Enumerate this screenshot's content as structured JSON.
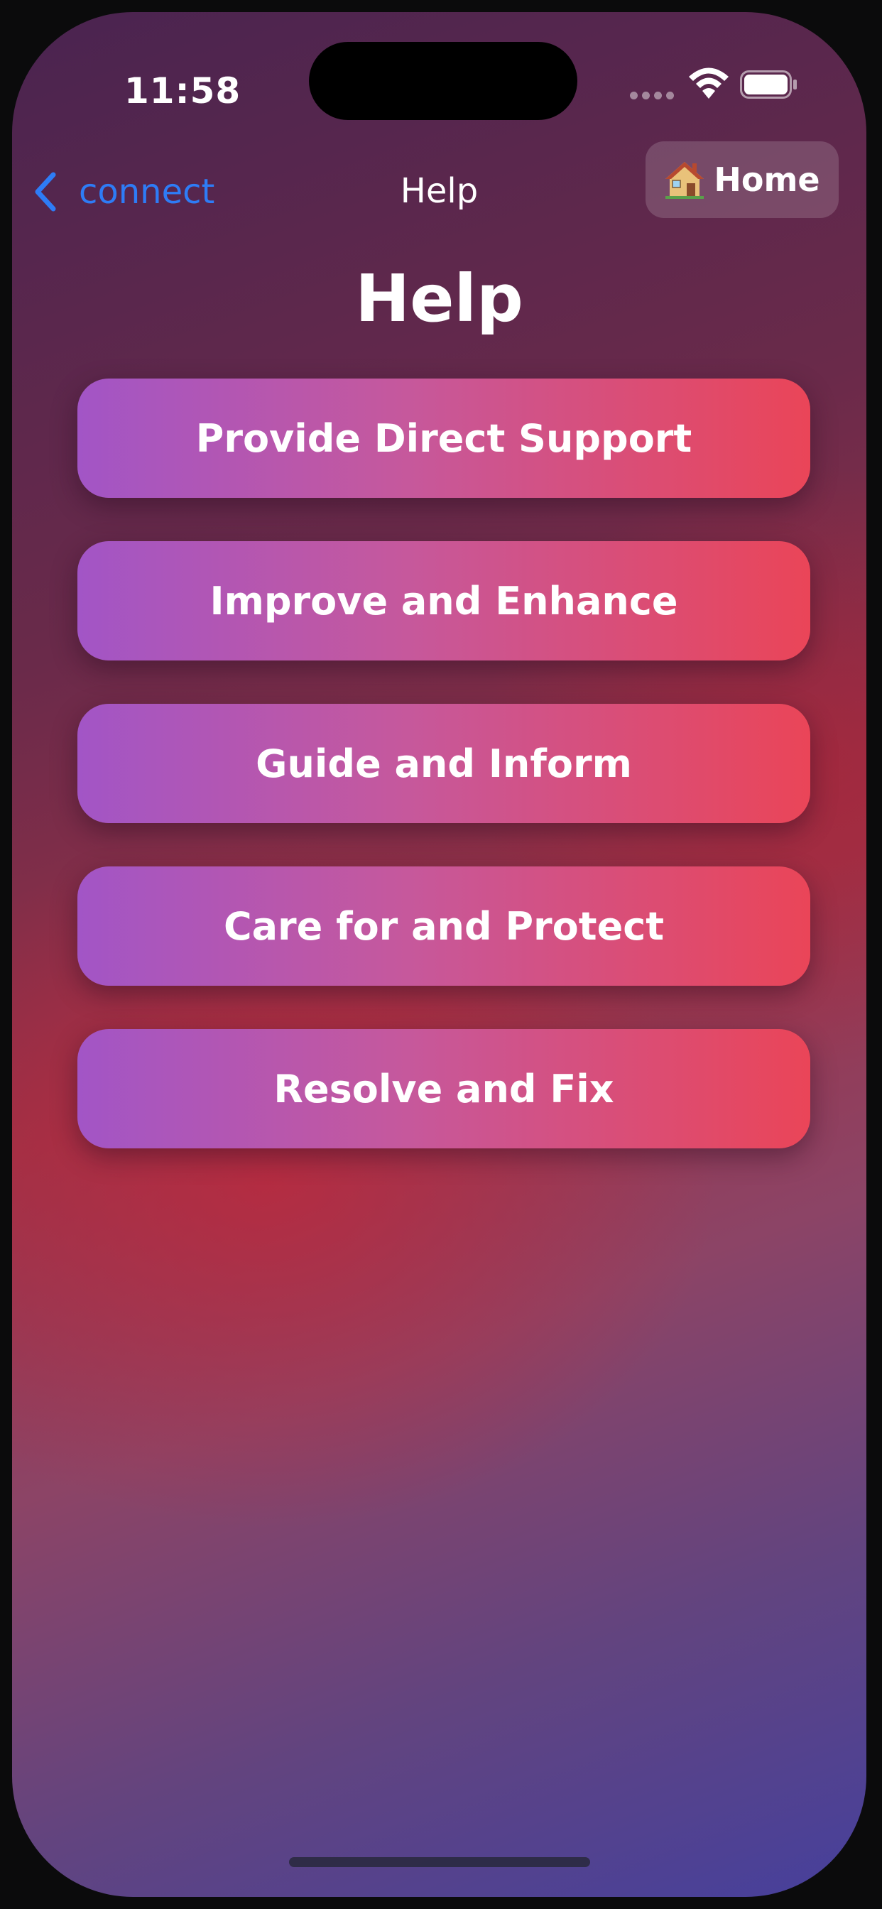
{
  "status_bar": {
    "time": "11:58"
  },
  "nav": {
    "back_label": "connect",
    "title": "Help",
    "home_label": "Home",
    "home_icon": "house-icon"
  },
  "page": {
    "title": "Help"
  },
  "options": [
    {
      "label": "Provide Direct Support"
    },
    {
      "label": "Improve and Enhance"
    },
    {
      "label": "Guide and Inform"
    },
    {
      "label": "Care for and Protect"
    },
    {
      "label": "Resolve and Fix"
    }
  ],
  "colors": {
    "back_link": "#2e7cf6",
    "button_gradient_start": "#a255c6",
    "button_gradient_end": "#ea4558",
    "text": "#ffffff"
  }
}
